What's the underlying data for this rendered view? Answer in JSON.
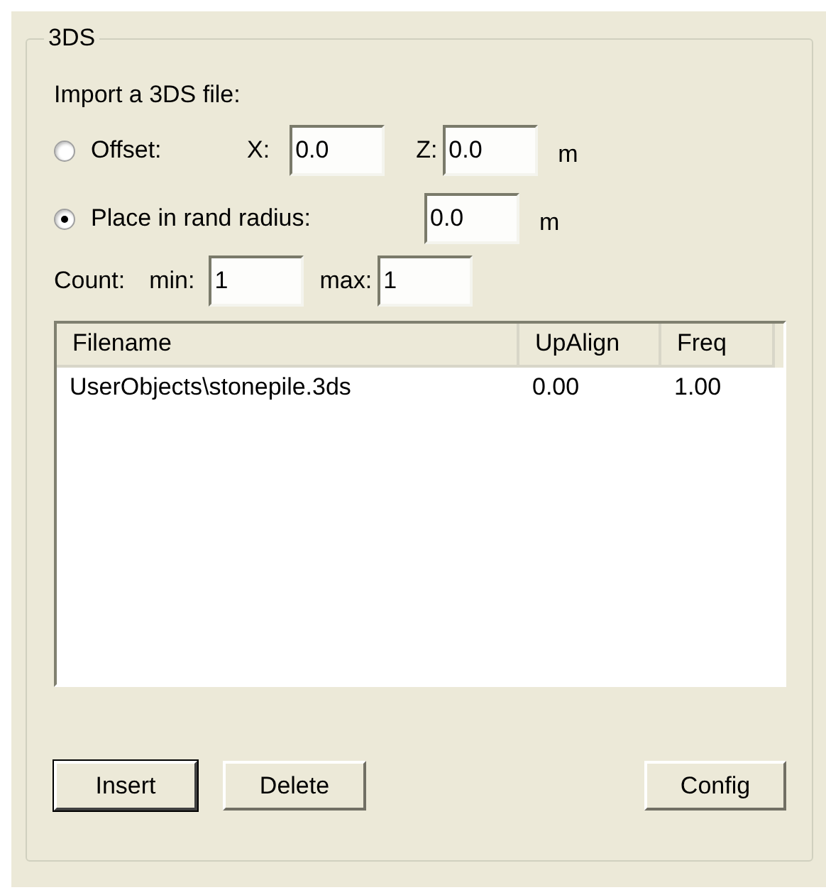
{
  "group": {
    "title": "3DS"
  },
  "import_label": "Import a 3DS file:",
  "placement": [
    {
      "kind": "offset",
      "label": "Offset:",
      "selected": false,
      "x_label": "X:",
      "x_value": "0.0",
      "z_label": "Z:",
      "z_value": "0.0",
      "unit": "m"
    },
    {
      "kind": "radius",
      "label": "Place in rand radius:",
      "selected": true,
      "value": "0.0",
      "unit": "m"
    }
  ],
  "count": {
    "label": "Count:",
    "min_label": "min:",
    "min_value": "1",
    "max_label": "max:",
    "max_value": "1"
  },
  "table": {
    "columns": [
      "Filename",
      "UpAlign",
      "Freq"
    ],
    "rows": [
      [
        "UserObjects\\stonepile.3ds",
        "0.00",
        "1.00"
      ]
    ]
  },
  "buttons": [
    {
      "label": "Insert",
      "default": true
    },
    {
      "label": "Delete",
      "default": false
    },
    {
      "label": "Config",
      "default": false
    }
  ]
}
